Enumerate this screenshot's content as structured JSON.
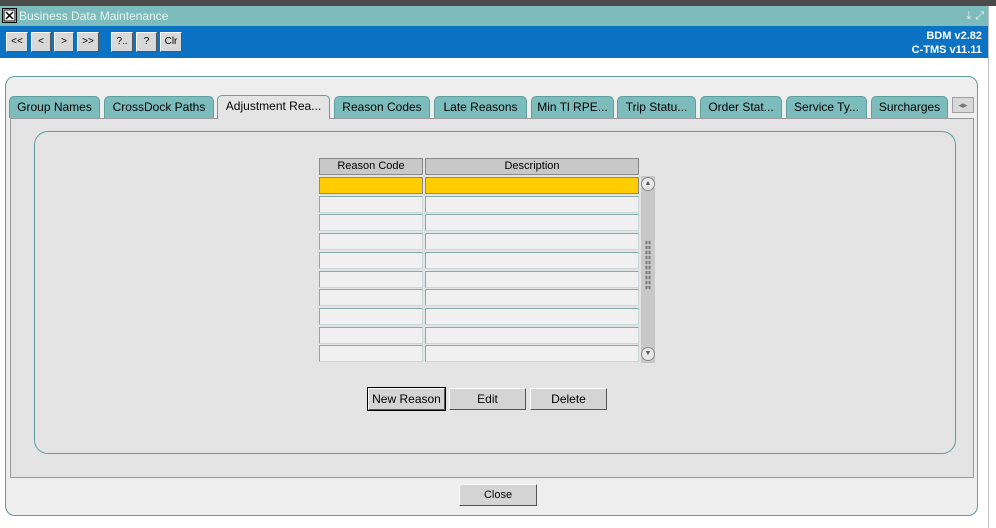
{
  "window": {
    "title": "Business Data Maintenance",
    "controls": [
      "minimize-icon",
      "restore-icon"
    ]
  },
  "toolbar": {
    "buttons": [
      "<<",
      "<",
      ">",
      ">>",
      "?..",
      "?",
      "Clr"
    ],
    "version_bdm": "BDM v2.82",
    "version_ctms": "C-TMS v11.11"
  },
  "tabs": [
    {
      "label": "Group Names",
      "active": false
    },
    {
      "label": "CrossDock Paths",
      "active": false
    },
    {
      "label": "Adjustment Rea...",
      "active": true
    },
    {
      "label": "Reason Codes",
      "active": false
    },
    {
      "label": "Late Reasons",
      "active": false
    },
    {
      "label": "Min Tl RPE...",
      "active": false
    },
    {
      "label": "Trip Statu...",
      "active": false
    },
    {
      "label": "Order Stat...",
      "active": false
    },
    {
      "label": "Service Ty...",
      "active": false
    },
    {
      "label": "Surcharges",
      "active": false
    }
  ],
  "grid": {
    "columns": [
      "Reason Code",
      "Description"
    ],
    "rows": [
      [
        "",
        ""
      ],
      [
        "",
        ""
      ],
      [
        "",
        ""
      ],
      [
        "",
        ""
      ],
      [
        "",
        ""
      ],
      [
        "",
        ""
      ],
      [
        "",
        ""
      ],
      [
        "",
        ""
      ],
      [
        "",
        ""
      ],
      [
        "",
        ""
      ]
    ],
    "selected_row": 0
  },
  "actions": {
    "new_reason": "New Reason",
    "edit": "Edit",
    "delete": "Delete"
  },
  "footer": {
    "close": "Close"
  },
  "colors": {
    "title_bar": "#7cbcbc",
    "toolbar": "#0b72c4",
    "selected_row": "#ffcc00"
  }
}
